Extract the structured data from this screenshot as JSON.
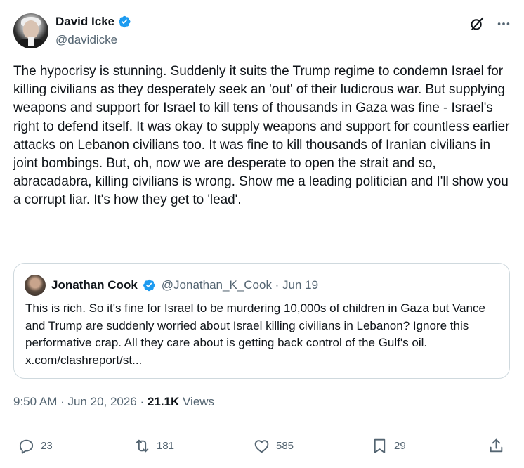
{
  "author": {
    "display_name": "David Icke",
    "handle": "@davidicke"
  },
  "tweet": {
    "text": "The hypocrisy is stunning. Suddenly it suits the Trump regime to condemn Israel for killing civilians as they desperately seek an 'out' of their ludicrous war. But supplying weapons and support for Israel to kill tens of thousands in Gaza was fine - Israel's right to defend itself. It was okay to supply weapons and support for countless earlier attacks on Lebanon civilians too. It was fine to kill thousands of Iranian civilians in joint bombings. But, oh, now we are desperate to open the strait and so, abracadabra, killing civilians is wrong. Show me a leading politician and I'll show you a corrupt liar. It's how they get to 'lead'."
  },
  "quote": {
    "display_name": "Jonathan Cook",
    "handle_date": "@Jonathan_K_Cook · Jun 19",
    "text": "This is rich. So it's fine for Israel to be murdering 10,000s of children in Gaza but Vance and Trump are suddenly worried about Israel killing civilians in Lebanon? Ignore this performative crap. All they care about is getting back control of the Gulf's oil. x.com/clashreport/st..."
  },
  "meta": {
    "timestamp": "9:50 AM · Jun 20, 2026 · ",
    "views_count": "21.1K",
    "views_label": " Views"
  },
  "actions": {
    "replies": "23",
    "reposts": "181",
    "likes": "585",
    "bookmarks": "29"
  },
  "colors": {
    "verified": "#1d9bf0",
    "secondary_text": "#536471",
    "primary_text": "#0f1419",
    "border": "#cfd9de"
  },
  "icons": [
    "verified-badge-icon",
    "grok-icon",
    "more-icon",
    "reply-icon",
    "repost-icon",
    "like-icon",
    "bookmark-icon",
    "share-icon"
  ]
}
